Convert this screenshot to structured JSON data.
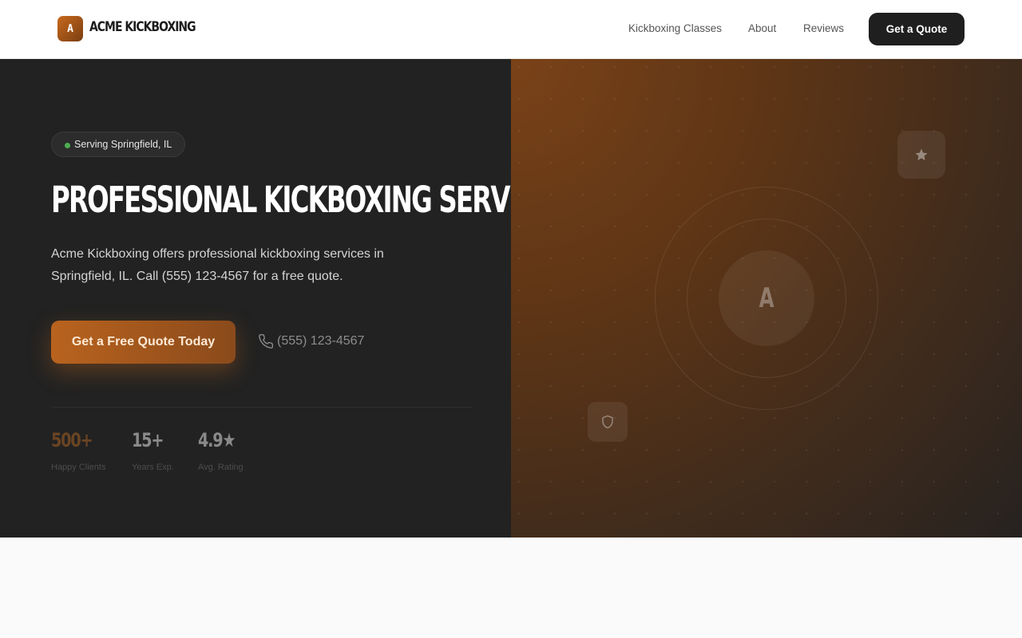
{
  "header": {
    "logo_letter": "A",
    "brand": "ACME KICKBOXING",
    "nav": [
      "Kickboxing Classes",
      "About",
      "Reviews"
    ],
    "cta_label": "Get a Quote"
  },
  "hero": {
    "badge": "Serving Springfield, IL",
    "title": "PROFESSIONAL KICKBOXING SERVICES",
    "description": "Acme Kickboxing offers professional kickboxing services in Springfield, IL. Call (555) 123-4567 for a free quote.",
    "cta_label": "Get a Free Quote Today",
    "phone": "(555) 123-4567",
    "stats": [
      {
        "value": "500+",
        "label": "Happy Clients"
      },
      {
        "value": "15+",
        "label": "Years Exp."
      },
      {
        "value": "4.9★",
        "label": "Avg. Rating"
      }
    ]
  },
  "visual": {
    "monogram": "A",
    "icons": [
      "star-icon",
      "shield-icon"
    ]
  },
  "colors": {
    "accent": "#c8691c",
    "dark": "#222222",
    "status_dot": "#4caf50"
  }
}
